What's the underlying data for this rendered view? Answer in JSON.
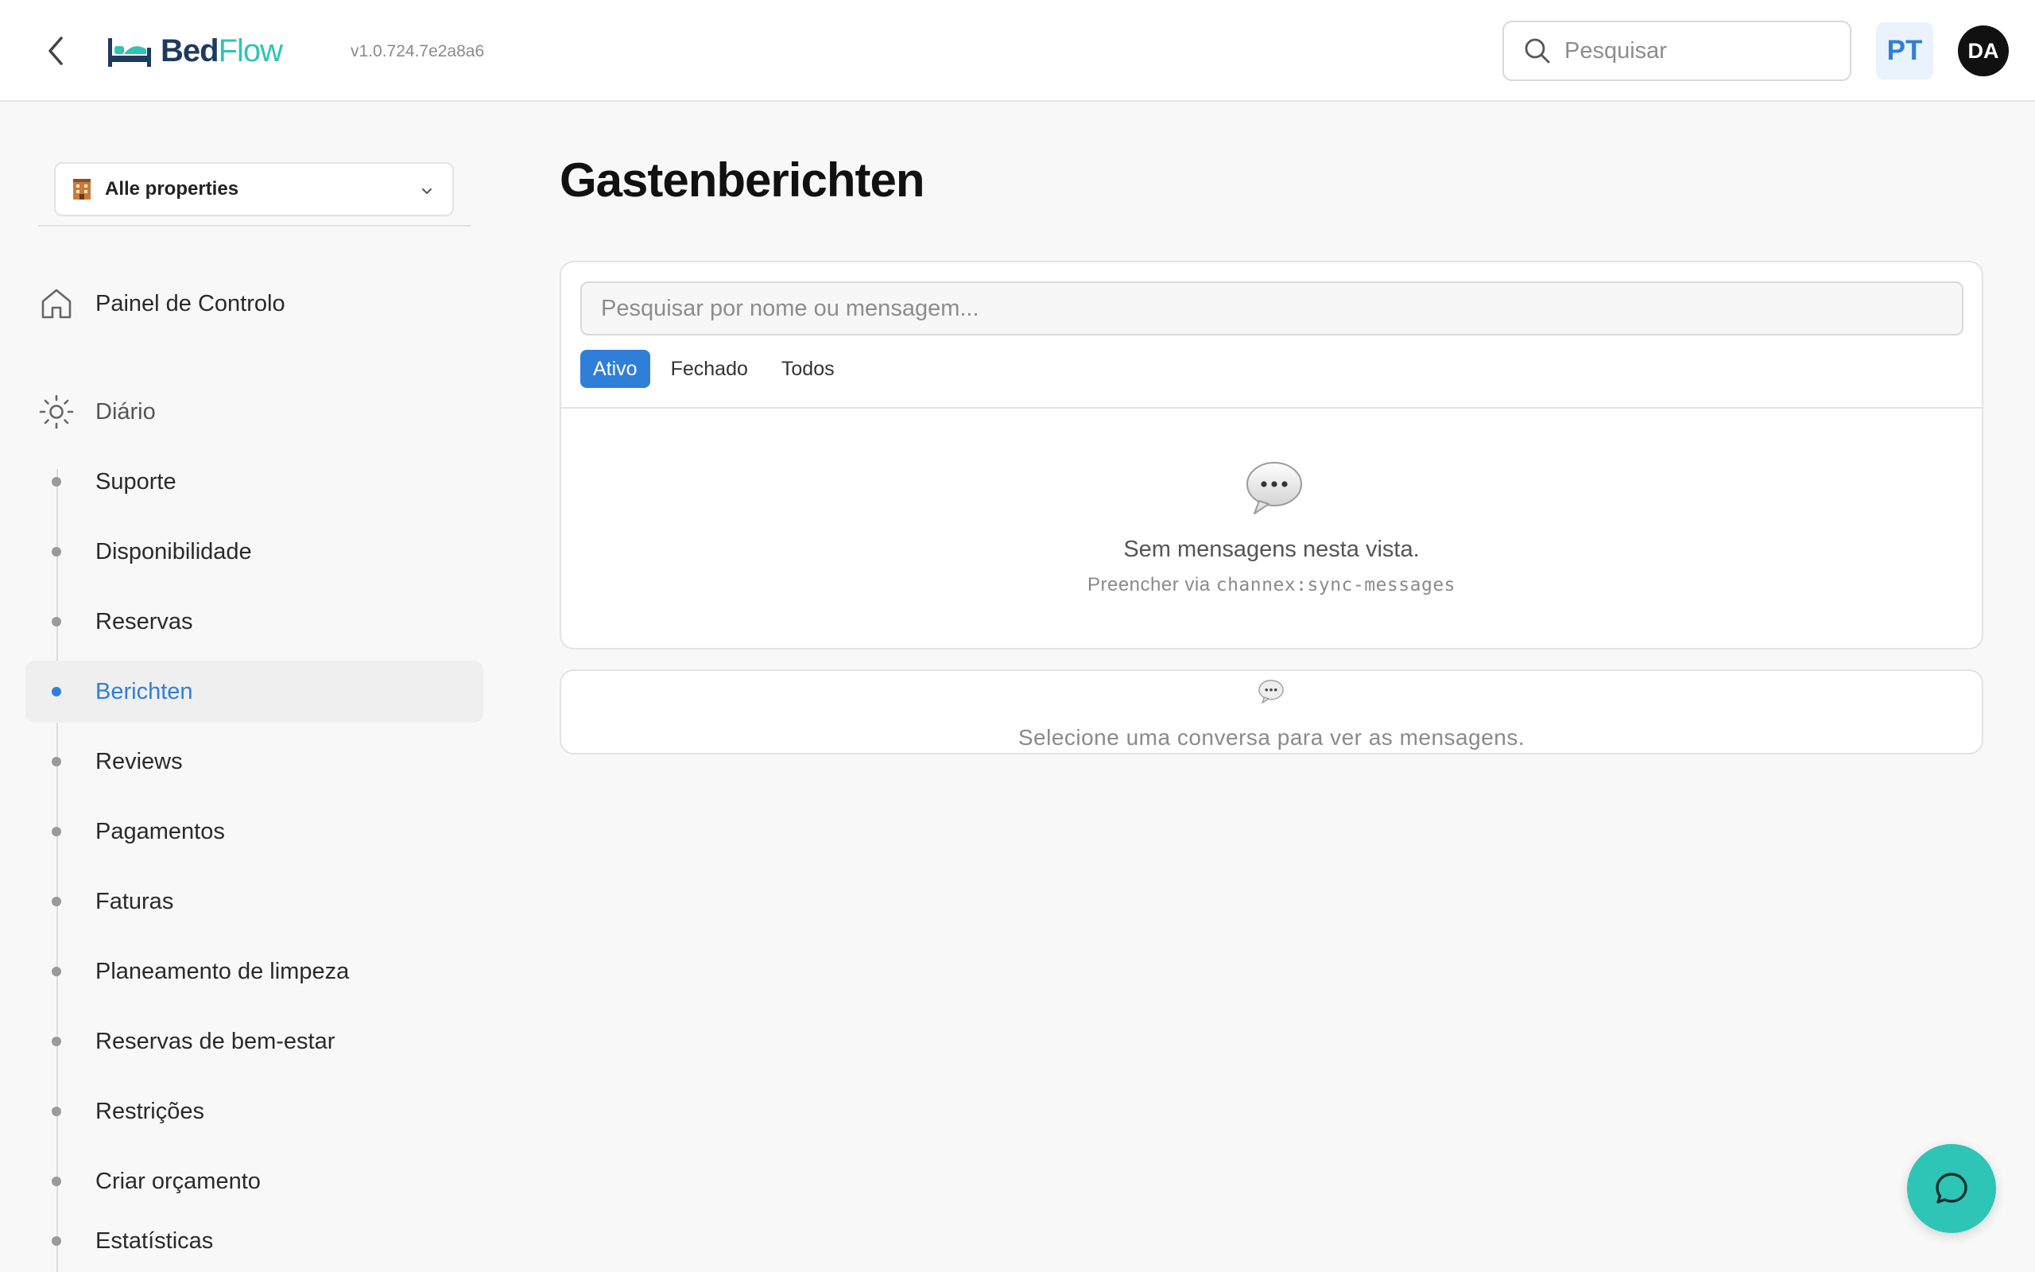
{
  "header": {
    "logo_bed": "Bed",
    "logo_flow": "Flow",
    "version": "v1.0.724.7e2a8a6",
    "search_placeholder": "Pesquisar",
    "language": "PT",
    "avatar_initials": "DA"
  },
  "sidebar": {
    "property_selector": "Alle properties",
    "dashboard_label": "Painel de Controlo",
    "group_label": "Diário",
    "items": [
      {
        "label": "Suporte",
        "active": false
      },
      {
        "label": "Disponibilidade",
        "active": false
      },
      {
        "label": "Reservas",
        "active": false
      },
      {
        "label": "Berichten",
        "active": true
      },
      {
        "label": "Reviews",
        "active": false
      },
      {
        "label": "Pagamentos",
        "active": false
      },
      {
        "label": "Faturas",
        "active": false
      },
      {
        "label": "Planeamento de limpeza",
        "active": false
      },
      {
        "label": "Reservas de bem-estar",
        "active": false
      },
      {
        "label": "Restrições",
        "active": false
      },
      {
        "label": "Criar orçamento",
        "active": false
      },
      {
        "label": "Estatísticas",
        "active": false
      }
    ]
  },
  "main": {
    "title": "Gastenberichten",
    "search_placeholder": "Pesquisar por nome ou mensagem...",
    "tabs": [
      {
        "label": "Ativo",
        "active": true
      },
      {
        "label": "Fechado",
        "active": false
      },
      {
        "label": "Todos",
        "active": false
      }
    ],
    "empty_text": "Sem mensagens nesta vista.",
    "empty_sub_prefix": "Preencher via ",
    "empty_sub_command": "channex:sync-messages",
    "select_prompt": "Selecione uma conversa para ver as mensagens."
  },
  "colors": {
    "accent": "#2f7fd9",
    "brand_teal": "#2ec4b6",
    "brand_navy": "#1f3a5f"
  }
}
